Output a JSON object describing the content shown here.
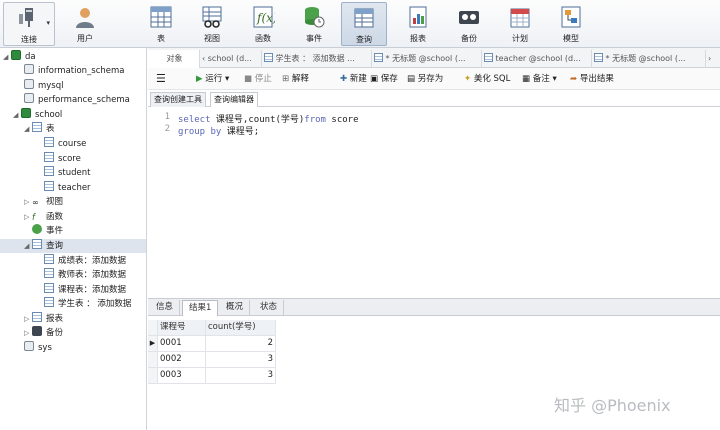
{
  "toolbar": {
    "connect": "连接",
    "user": "用户",
    "table": "表",
    "view": "视图",
    "function": "函数",
    "event": "事件",
    "query": "查询",
    "report": "报表",
    "backup": "备份",
    "schedule": "计划",
    "model": "模型"
  },
  "tree": {
    "connection": "da",
    "databases": [
      "information_schema",
      "mysql",
      "performance_schema",
      "school"
    ],
    "tables_label": "表",
    "tables": [
      "course",
      "score",
      "student",
      "teacher"
    ],
    "views_label": "视图",
    "functions_label": "函数",
    "events_label": "事件",
    "queries_label": "查询",
    "queries": [
      "成绩表：添加数据",
      "教师表：添加数据",
      "课程表：添加数据",
      "学生表 ： 添加数据"
    ],
    "reports_label": "报表",
    "backups_label": "备份",
    "sys": "sys"
  },
  "tabs": {
    "objects": "对象",
    "tab1": "school (d...",
    "tab2": "学生表 ： 添加数据 ...",
    "tab3": "* 无标题 @school (...",
    "tab4": "teacher @school (d...",
    "tab5": "* 无标题 @school (..."
  },
  "query_toolbar": {
    "run": "运行",
    "stop": "停止",
    "explain": "解释",
    "new": "新建",
    "save": "保存",
    "save_as": "另存为",
    "beautify": "美化 SQL",
    "comment": "备注",
    "export": "导出结果"
  },
  "subtabs": {
    "builder": "查询创建工具",
    "editor": "查询编辑器"
  },
  "editor": {
    "line1_no": "1",
    "line2_no": "2",
    "l1_kw1": "select",
    "l1_mid": " 课程号,count(学号)",
    "l1_kw2": "from",
    "l1_end": " score",
    "l2_kw": "group by",
    "l2_end": " 课程号;"
  },
  "result_tabs": {
    "info": "信息",
    "result1": "结果1",
    "profile": "概况",
    "status": "状态"
  },
  "grid": {
    "columns": [
      "课程号",
      "count(学号)"
    ],
    "rows": [
      {
        "c1": "0001",
        "c2": "2"
      },
      {
        "c1": "0002",
        "c2": "3"
      },
      {
        "c1": "0003",
        "c2": "3"
      }
    ]
  },
  "watermark": "知乎 @Phoenix",
  "colors": {
    "accent": "#5a67b6",
    "selection": "#dde4ee",
    "run_green": "#2f9a3a"
  }
}
